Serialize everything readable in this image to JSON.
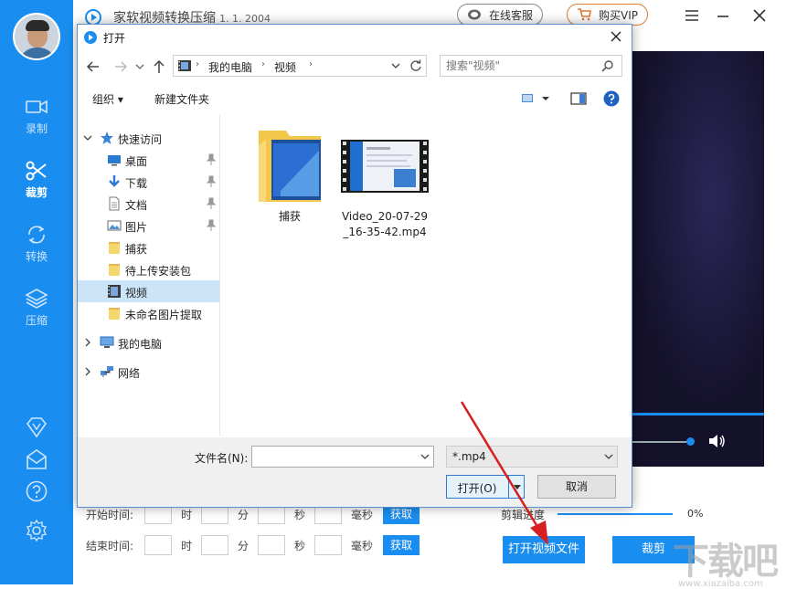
{
  "app": {
    "title": "家软视频转换压缩",
    "version": "1. 1. 2004",
    "service_label": "在线客服",
    "vip_label": "购买VIP"
  },
  "sidebar": {
    "items": [
      {
        "label": "录制",
        "icon": "video-camera-icon"
      },
      {
        "label": "裁剪",
        "icon": "scissors-icon",
        "active": true
      },
      {
        "label": "转换",
        "icon": "convert-icon"
      },
      {
        "label": "压缩",
        "icon": "layers-icon"
      }
    ],
    "bottom_icons": [
      "diamond-icon",
      "mail-icon",
      "help-icon",
      "settings-icon"
    ]
  },
  "editor": {
    "start_label": "开始时间:",
    "end_label": "结束时间:",
    "unit_hour": "时",
    "unit_min": "分",
    "unit_sec": "秒",
    "unit_ms": "毫秒",
    "get_label": "获取",
    "progress_label": "剪辑进度",
    "progress_value": "0%",
    "open_video_label": "打开视频文件",
    "crop_label": "裁剪"
  },
  "watermark": {
    "text": "下载吧",
    "sub": "www.xiazaiba.com"
  },
  "dialog": {
    "title": "打开",
    "breadcrumb": [
      "我的电脑",
      "视频"
    ],
    "search_placeholder": "搜索\"视频\"",
    "organize_label": "组织",
    "new_folder_label": "新建文件夹",
    "tree": [
      {
        "label": "快速访问",
        "icon": "star-icon",
        "expanded": true
      },
      {
        "label": "桌面",
        "icon": "desktop-icon",
        "pinned": true
      },
      {
        "label": "下载",
        "icon": "download-icon",
        "pinned": true
      },
      {
        "label": "文档",
        "icon": "document-icon",
        "pinned": true
      },
      {
        "label": "图片",
        "icon": "picture-icon",
        "pinned": true
      },
      {
        "label": "捕获",
        "icon": "folder-icon"
      },
      {
        "label": "待上传安装包",
        "icon": "folder-icon"
      },
      {
        "label": "视频",
        "icon": "video-folder-icon",
        "selected": true
      },
      {
        "label": "未命名图片提取",
        "icon": "folder-icon"
      },
      {
        "label": "我的电脑",
        "icon": "computer-icon",
        "collapsed": true
      },
      {
        "label": "网络",
        "icon": "network-icon",
        "collapsed": true
      }
    ],
    "files": [
      {
        "name": "捕获",
        "type": "folder"
      },
      {
        "name": "Video_20-07-29_16-35-42.mp4",
        "type": "video"
      }
    ],
    "filename_label": "文件名(N):",
    "filename_value": "",
    "filetype_value": "*.mp4",
    "open_label": "打开(O)",
    "cancel_label": "取消"
  },
  "colors": {
    "accent": "#1a8ef0",
    "arrow": "#d62020"
  }
}
